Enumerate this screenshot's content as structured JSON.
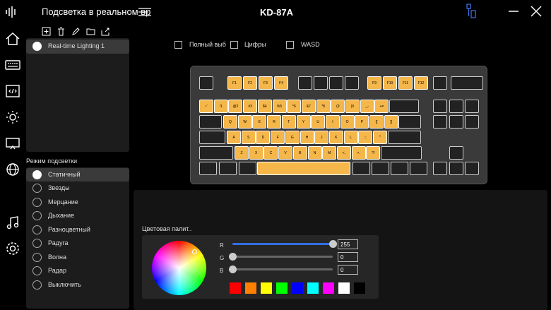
{
  "titlebar": {
    "app_title": "Подсветка в реальном вр",
    "device_name": "KD-87A"
  },
  "profiles": {
    "items": [
      {
        "label": "Real-time Lighting 1",
        "selected": true
      }
    ]
  },
  "modes": {
    "header": "Режим подсветки",
    "items": [
      {
        "label": "Статичный",
        "selected": true
      },
      {
        "label": "Звезды",
        "selected": false
      },
      {
        "label": "Мерцание",
        "selected": false
      },
      {
        "label": "Дыхание",
        "selected": false
      },
      {
        "label": "Разноцветный",
        "selected": false
      },
      {
        "label": "Радуга",
        "selected": false
      },
      {
        "label": "Волна",
        "selected": false
      },
      {
        "label": "Радар",
        "selected": false
      },
      {
        "label": "Выключить",
        "selected": false
      }
    ]
  },
  "selection": {
    "full_label": "Полный выб",
    "digits_label": "Цифры",
    "wasd_label": "WASD"
  },
  "keyboard": {
    "row_fn": [
      "",
      "F1",
      "F2",
      "F3",
      "F4",
      "",
      "",
      "",
      "",
      "F9",
      "F10",
      "F11",
      "F12",
      "",
      ""
    ],
    "row1": [
      "~`",
      "!1",
      "@2",
      "#3",
      "$4",
      "%5",
      "^6",
      "&7",
      "*8",
      "(9",
      ")0",
      "_-",
      "+=",
      "",
      "",
      "",
      ""
    ],
    "row2": [
      "",
      "Q",
      "W",
      "E",
      "R",
      "T",
      "Y",
      "U",
      "I",
      "O",
      "P",
      "{[",
      "}]",
      "|\\",
      "",
      "",
      ""
    ],
    "row3": [
      "",
      "A",
      "S",
      "D",
      "F",
      "G",
      "H",
      "J",
      "K",
      "L",
      ":;",
      "\"'",
      ""
    ],
    "row4": [
      "",
      "Z",
      "X",
      "C",
      "V",
      "B",
      "N",
      "M",
      "<,",
      ">.",
      "?/",
      "",
      ""
    ],
    "row5": [
      "",
      "",
      "",
      "",
      "",
      "",
      "",
      "",
      "",
      "",
      ""
    ]
  },
  "palette": {
    "title": "Цветовая палит..",
    "r_label": "R",
    "g_label": "G",
    "b_label": "B",
    "r_value": "255",
    "g_value": "0",
    "b_value": "0",
    "r_fraction": 1.0,
    "g_fraction": 0.0,
    "b_fraction": 0.0,
    "swatches": [
      "#ff0000",
      "#ff8000",
      "#ffff00",
      "#00ff00",
      "#0000ff",
      "#00ffff",
      "#ff00ff",
      "#ffffff",
      "#000000"
    ]
  },
  "colors": {
    "accent": "#2f6fe6",
    "key_lit": "#f5b74a",
    "key_dark": "#222222"
  }
}
